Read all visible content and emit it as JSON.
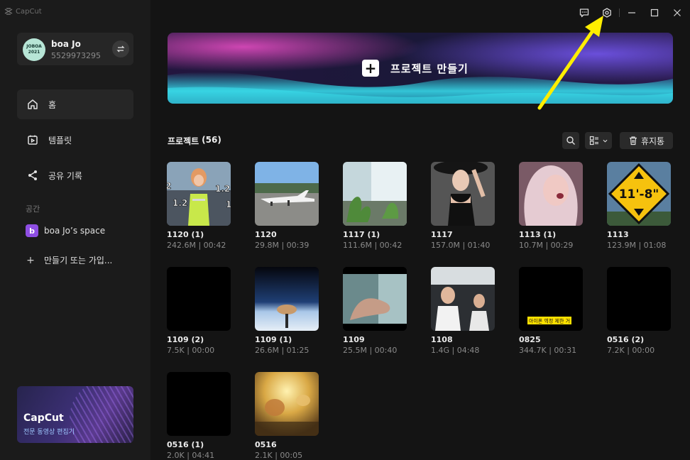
{
  "app": {
    "title": "CapCut"
  },
  "user": {
    "avatar_text_1": "JOBOA",
    "avatar_text_2": "2021",
    "name": "boa Jo",
    "id": "5529973295"
  },
  "nav": [
    {
      "label": "홈",
      "icon": "home-icon",
      "active": true
    },
    {
      "label": "템플릿",
      "icon": "template-icon",
      "active": false
    },
    {
      "label": "공유 기록",
      "icon": "share-icon",
      "active": false
    }
  ],
  "spaces": {
    "label": "공간",
    "space_badge": "b",
    "space_name": "boa Jo’s space",
    "join_label": "만들기 또는 가입..."
  },
  "promo": {
    "title": "CapCut",
    "subtitle": "전문 동영상 편집기"
  },
  "banner": {
    "label": "프로젝트 만들기"
  },
  "projects": {
    "label": "프로젝트",
    "count": "(56)",
    "trash_label": "휴지통",
    "items": [
      {
        "title": "1120 (1)",
        "meta": "242.6M | 00:42"
      },
      {
        "title": "1120",
        "meta": "29.8M | 00:39"
      },
      {
        "title": "1117 (1)",
        "meta": "111.6M | 00:42"
      },
      {
        "title": "1117",
        "meta": "157.0M | 01:40"
      },
      {
        "title": "1113 (1)",
        "meta": "10.7M | 00:29"
      },
      {
        "title": "1113",
        "meta": "123.9M | 01:08"
      },
      {
        "title": "1109 (2)",
        "meta": "7.5K | 00:00"
      },
      {
        "title": "1109 (1)",
        "meta": "26.6M | 01:25"
      },
      {
        "title": "1109",
        "meta": "25.5M | 00:40"
      },
      {
        "title": "1108",
        "meta": "1.4G | 04:48"
      },
      {
        "title": "0825",
        "meta": "344.7K | 00:31"
      },
      {
        "title": "0516 (2)",
        "meta": "7.2K | 00:00"
      },
      {
        "title": "0516 (1)",
        "meta": "2.0K | 04:41"
      },
      {
        "title": "0516",
        "meta": "2.1K | 00:05"
      }
    ]
  },
  "thumb_text": {
    "t0_a": "1.2",
    "t0_b": "1.2",
    "t0_c": "2",
    "t0_d": "1",
    "t5_sign": "11'-8\"",
    "t10_caption": "아이폰 역정 제한 거"
  },
  "colors": {
    "accent": "#ffee00",
    "sidebar": "#1b1b1b",
    "background": "#141414"
  }
}
